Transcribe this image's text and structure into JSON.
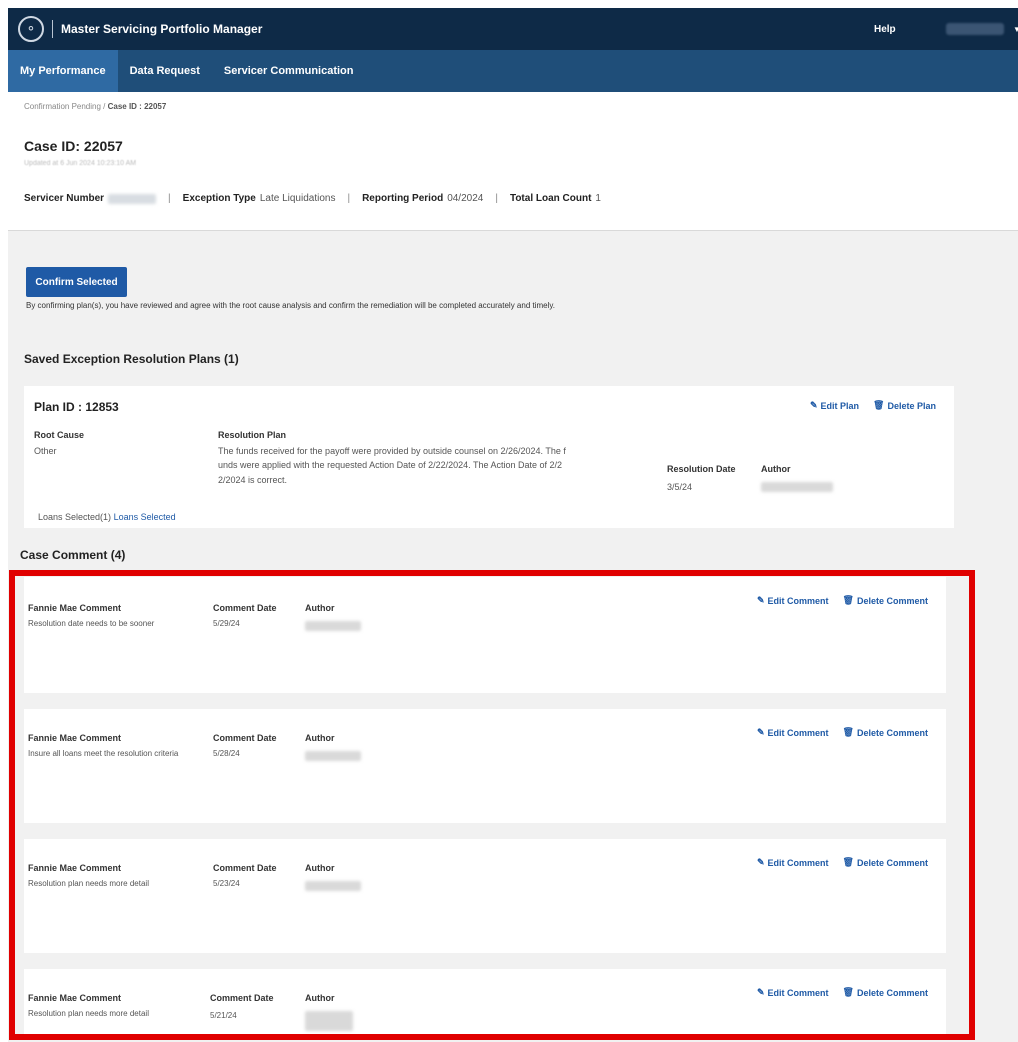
{
  "app": {
    "title": "Master Servicing Portfolio Manager",
    "help": "Help"
  },
  "nav": [
    {
      "label": "My Performance"
    },
    {
      "label": "Data Request"
    },
    {
      "label": "Servicer Communication"
    }
  ],
  "breadcrumb": {
    "parent": "Confirmation Pending",
    "current": "Case ID : 22057"
  },
  "case": {
    "title": "Case ID: 22057",
    "updated": "Updated at 6 Jun 2024 10:23:10 AM",
    "servicer_number_label": "Servicer Number",
    "exception_type_label": "Exception Type",
    "exception_type_value": "Late Liquidations",
    "reporting_period_label": "Reporting Period",
    "reporting_period_value": "04/2024",
    "total_loan_count_label": "Total Loan Count",
    "total_loan_count_value": "1"
  },
  "confirm": {
    "button": "Confirm Selected",
    "note": "By confirming plan(s), you have reviewed and agree with the root cause analysis and confirm the remediation will be completed accurately and timely."
  },
  "plans": {
    "title": "Saved Exception Resolution Plans (1)",
    "plan_id": "Plan ID : 12853",
    "edit": "Edit Plan",
    "delete": "Delete Plan",
    "root_cause_label": "Root Cause",
    "root_cause_value": "Other",
    "resolution_plan_label": "Resolution Plan",
    "resolution_plan_line1": "The funds received for the payoff were provided by outside counsel on 2/26/2024. The f",
    "resolution_plan_line2": "unds were applied with the requested Action Date of 2/22/2024. The Action Date of 2/2",
    "resolution_plan_line3": "2/2024 is correct.",
    "resolution_date_label": "Resolution Date",
    "resolution_date_value": "3/5/24",
    "author_label": "Author",
    "loans_selected_prefix": "Loans Selected(1)",
    "loans_selected_link": "Loans Selected"
  },
  "comments": {
    "title": "Case Comment (4)",
    "comment_label": "Fannie Mae Comment",
    "date_label": "Comment Date",
    "author_label": "Author",
    "edit": "Edit Comment",
    "delete": "Delete Comment",
    "items": [
      {
        "text": "Resolution date needs to be sooner",
        "date": "5/29/24"
      },
      {
        "text": "Insure all loans meet the resolution criteria",
        "date": "5/28/24"
      },
      {
        "text": "Resolution plan needs more detail",
        "date": "5/23/24"
      },
      {
        "text": "Resolution plan needs more detail",
        "date": "5/21/24"
      }
    ]
  }
}
